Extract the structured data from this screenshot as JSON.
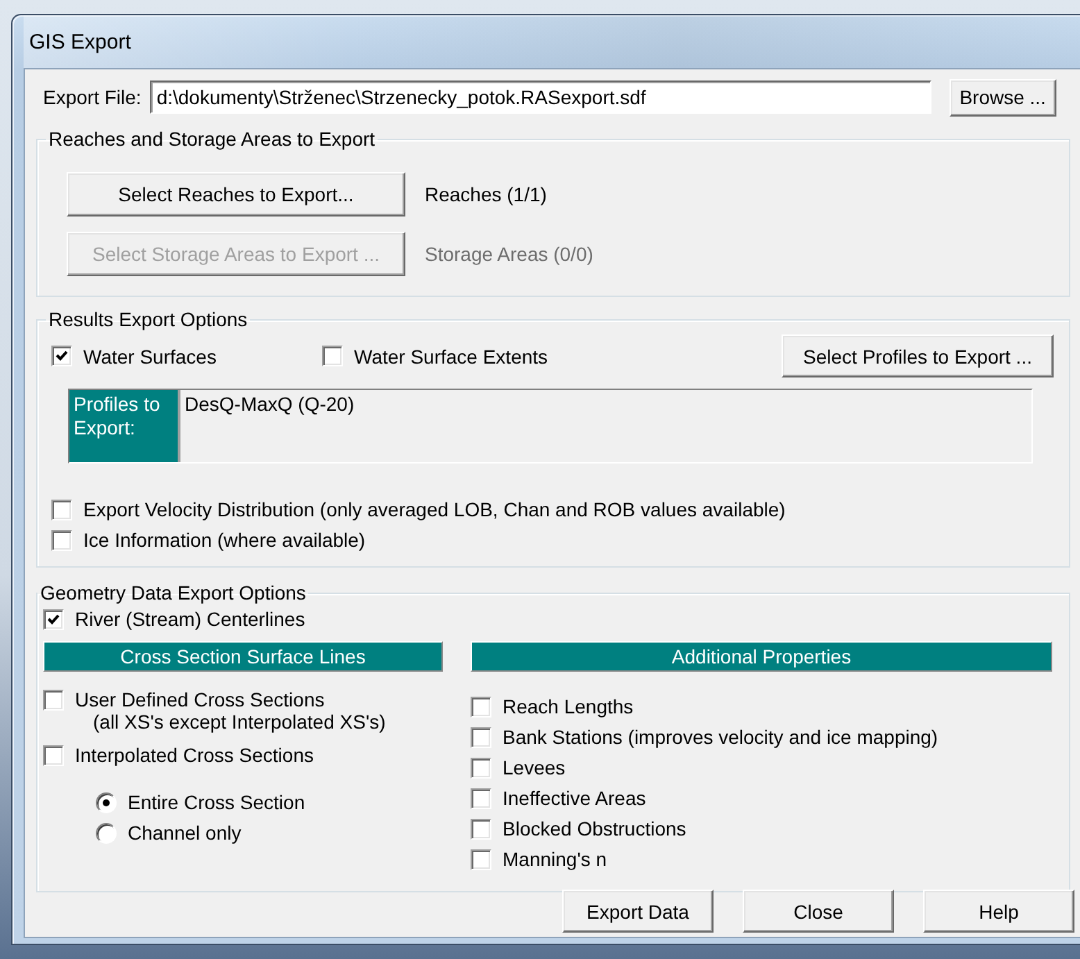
{
  "window": {
    "title": "GIS Export"
  },
  "export_file": {
    "label": "Export File:",
    "value": "d:\\dokumenty\\Strženec\\Strzenecky_potok.RASexport.sdf",
    "browse": "Browse ..."
  },
  "reaches_group": {
    "title": "Reaches and Storage Areas to Export",
    "rows": [
      {
        "button": "Select Reaches to Export...",
        "disabled": false,
        "status": "Reaches (1/1)"
      },
      {
        "button": "Select Storage Areas to Export ...",
        "disabled": true,
        "status": "Storage Areas (0/0)"
      }
    ]
  },
  "results_group": {
    "title": "Results Export Options",
    "options": [
      {
        "label": "Water Surfaces",
        "checked": true
      },
      {
        "label": "Water Surface Extents",
        "checked": false
      }
    ],
    "profiles_button": "Select Profiles to Export ...",
    "profiles_label": "Profiles to Export:",
    "profiles": [
      "DesQ-MaxQ (Q-20)"
    ],
    "extra_options": [
      {
        "label": "Export Velocity Distribution (only averaged LOB, Chan and ROB values available)",
        "checked": false
      },
      {
        "label": "Ice Information (where available)",
        "checked": false
      }
    ]
  },
  "geometry_group": {
    "title": "Geometry Data Export Options",
    "centerlines": {
      "label": "River (Stream) Centerlines",
      "checked": true
    },
    "cross_sections": {
      "header": "Cross Section Surface Lines",
      "options": [
        {
          "label": "User Defined Cross Sections",
          "note": "(all XS's except Interpolated XS's)",
          "checked": false
        },
        {
          "label": "Interpolated Cross Sections",
          "checked": false
        }
      ],
      "extent": [
        {
          "label": "Entire Cross Section",
          "selected": true
        },
        {
          "label": "Channel only",
          "selected": false
        }
      ]
    },
    "additional": {
      "header": "Additional Properties",
      "options": [
        {
          "label": "Reach Lengths",
          "checked": false
        },
        {
          "label": "Bank Stations (improves velocity and ice mapping)",
          "checked": false
        },
        {
          "label": "Levees",
          "checked": false
        },
        {
          "label": "Ineffective Areas",
          "checked": false
        },
        {
          "label": "Blocked Obstructions",
          "checked": false
        },
        {
          "label": "Manning's n",
          "checked": false
        }
      ]
    }
  },
  "buttons": [
    "Export Data",
    "Close",
    "Help"
  ]
}
